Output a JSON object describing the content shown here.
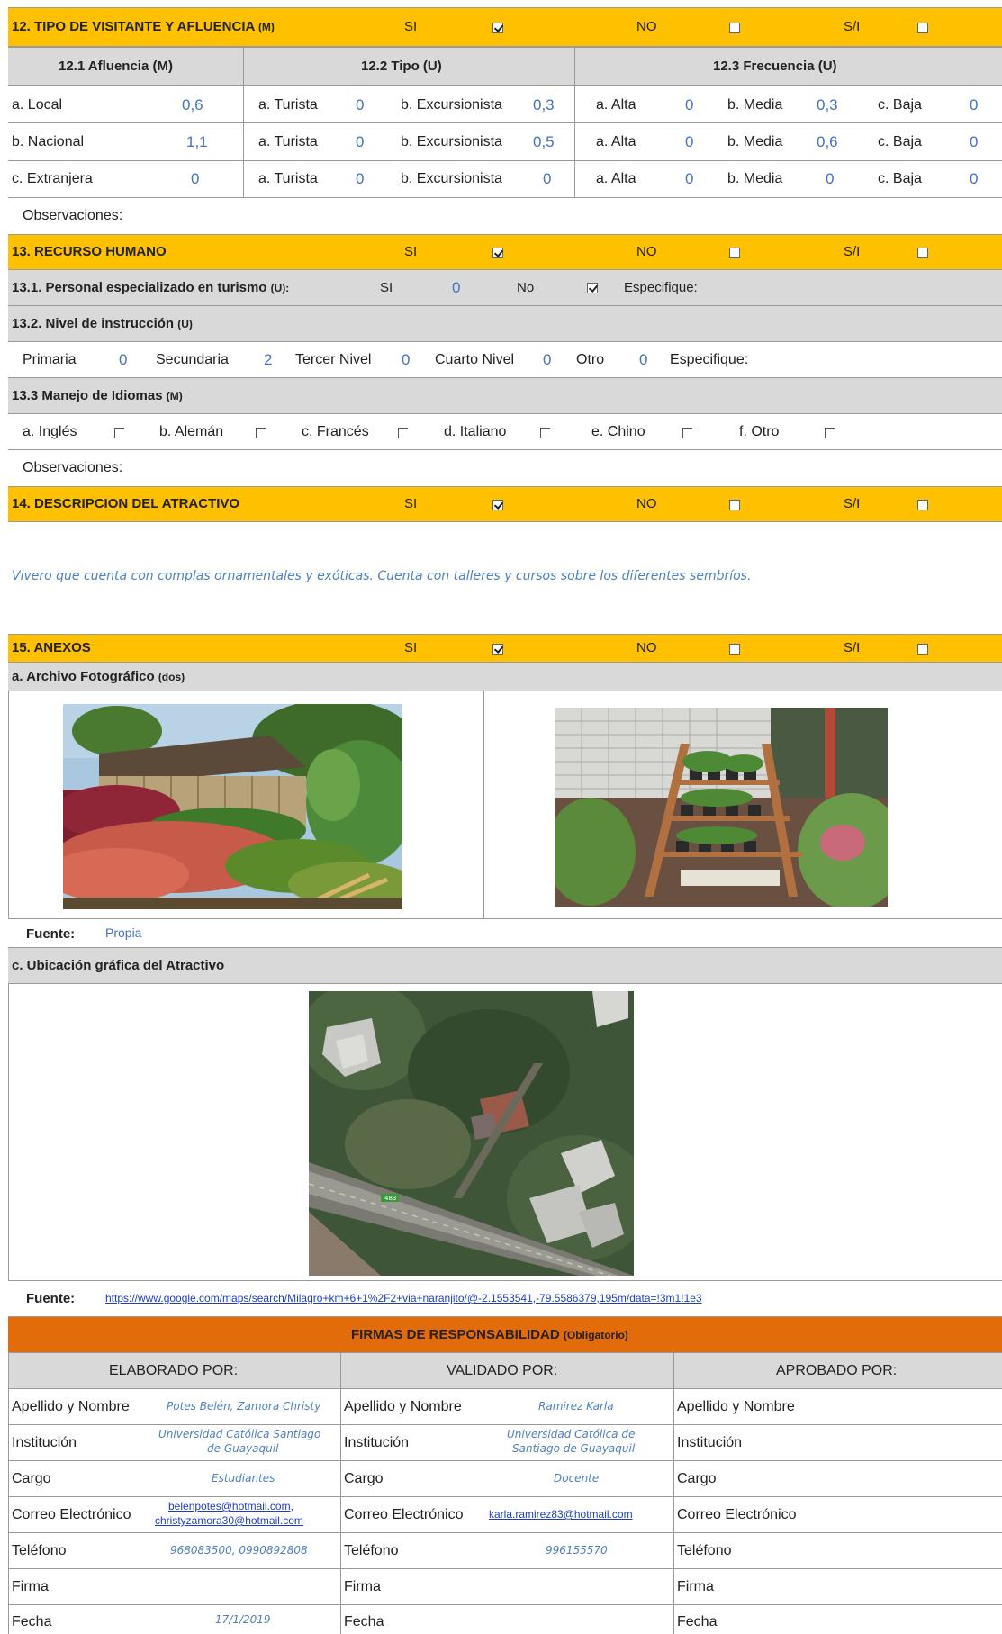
{
  "s12": {
    "title": "12. TIPO DE VISITANTE Y AFLUENCIA",
    "title_suffix": "(M)",
    "si": "SI",
    "no": "NO",
    "si_mark": "S/I",
    "col1_header": "12.1 Afluencia (M)",
    "col2_header": "12.2 Tipo (U)",
    "col3_header": "12.3 Frecuencia (U)",
    "rows": [
      {
        "origin": "a. Local",
        "origin_val": "0,6",
        "turista": "a. Turista",
        "turista_val": "0",
        "excursionista": "b. Excursionista",
        "excursionista_val": "0,3",
        "alta": "a. Alta",
        "alta_val": "0",
        "media": "b. Media",
        "media_val": "0,3",
        "baja": "c. Baja",
        "baja_val": "0"
      },
      {
        "origin": "b. Nacional",
        "origin_val": "1,1",
        "turista": "a. Turista",
        "turista_val": "0",
        "excursionista": "b. Excursionista",
        "excursionista_val": "0,5",
        "alta": "a. Alta",
        "alta_val": "0",
        "media": "b. Media",
        "media_val": "0,6",
        "baja": "c. Baja",
        "baja_val": "0"
      },
      {
        "origin": "c. Extranjera",
        "origin_val": "0",
        "turista": "a. Turista",
        "turista_val": "0",
        "excursionista": "b. Excursionista",
        "excursionista_val": "0",
        "alta": "a. Alta",
        "alta_val": "0",
        "media": "b. Media",
        "media_val": "0",
        "baja": "c. Baja",
        "baja_val": "0"
      }
    ],
    "observaciones": "Observaciones:"
  },
  "s13": {
    "title": "13. RECURSO HUMANO",
    "si": "SI",
    "no": "NO",
    "si_mark": "S/I",
    "personal_label": "13.1. Personal especializado en turismo",
    "personal_suffix": "(U):",
    "personal_si": "SI",
    "personal_si_val": "0",
    "personal_no": "No",
    "especifique": "Especifique:",
    "nivel_label": "13.2. Nivel de instrucción",
    "nivel_suffix": "(U)",
    "niveles": [
      {
        "label": "Primaria",
        "value": "0"
      },
      {
        "label": "Secundaria",
        "value": "2"
      },
      {
        "label": "Tercer Nivel",
        "value": "0"
      },
      {
        "label": "Cuarto Nivel",
        "value": "0"
      },
      {
        "label": "Otro",
        "value": "0"
      }
    ],
    "nivel_especifique": "Especifique:",
    "idiomas_label": "13.3 Manejo de Idiomas",
    "idiomas_suffix": "(M)",
    "idiomas": [
      "a. Inglés",
      "b. Alemán",
      "c. Francés",
      "d. Italiano",
      "e. Chino",
      "f. Otro"
    ],
    "observaciones": "Observaciones:"
  },
  "s14": {
    "title": "14. DESCRIPCION DEL ATRACTIVO",
    "si": "SI",
    "no": "NO",
    "si_mark": "S/I",
    "description": "Vivero que cuenta con complas ornamentales y exóticas. Cuenta con talleres y cursos sobre los diferentes sembríos."
  },
  "s15": {
    "title": "15. ANEXOS",
    "si": "SI",
    "no": "NO",
    "si_mark": "S/I",
    "archivo_label": "a. Archivo Fotográfico",
    "archivo_suffix": "(dos)",
    "fuente_label": "Fuente:",
    "fuente_value": "Propia",
    "ubicacion_label": "c. Ubicación gráfica del Atractivo",
    "map_road_label": "483",
    "fuente2_label": "Fuente:",
    "fuente2_url": "https://www.google.com/maps/search/Milagro+km+6+1%2F2+via+naranjito/@-2.1553541,-79.5586379,195m/data=!3m1!1e3"
  },
  "firmas": {
    "title": "FIRMAS DE RESPONSABILIDAD",
    "title_suffix": "(Obligatorio)",
    "col_headers": [
      "ELABORADO POR:",
      "VALIDADO  POR:",
      "APROBADO POR:"
    ],
    "row_labels": [
      "Apellido y Nombre",
      "Institución",
      "Cargo",
      "Correo Electrónico",
      "Teléfono",
      "Firma",
      "Fecha"
    ],
    "elaborado": {
      "nombre": "Potes Belén, Zamora Christy",
      "institucion_1": "Universidad Católica Santiago",
      "institucion_2": "de Guayaquil",
      "cargo": "Estudiantes",
      "correo_1": "belenpotes@hotmail.com,",
      "correo_2": "christyzamora30@hotmail.com",
      "telefono": "968083500, 0990892808",
      "fecha": "17/1/2019"
    },
    "validado": {
      "nombre": "Ramirez Karla",
      "institucion_1": "Universidad Católica de",
      "institucion_2": "Santiago de Guayaquil",
      "cargo": "Docente",
      "correo": "karla.ramirez83@hotmail.com",
      "telefono": "996155570"
    }
  }
}
